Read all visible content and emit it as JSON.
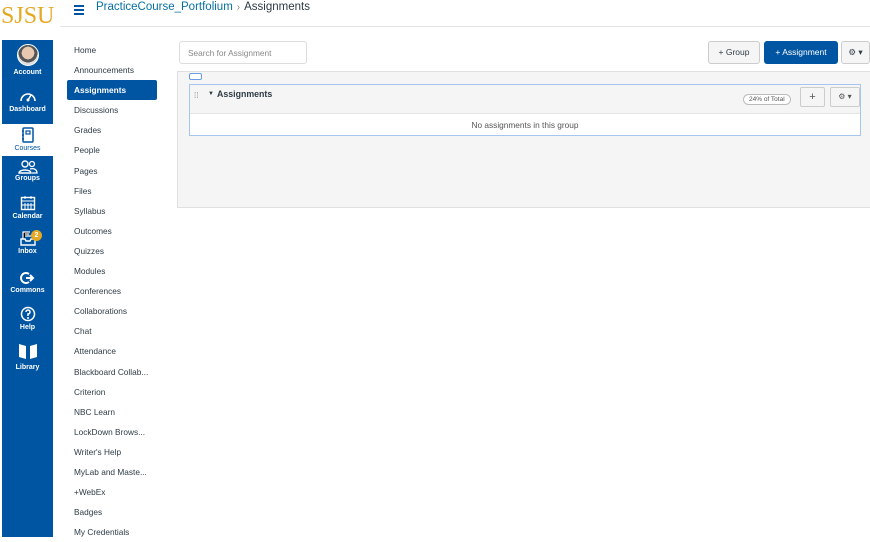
{
  "logo": "SJSU",
  "header": {
    "breadcrumb": [
      {
        "label": "PracticeCourse_Portfolium"
      },
      {
        "label": "Assignments"
      }
    ],
    "separator": "›"
  },
  "global_nav": [
    {
      "label": "Account",
      "icon": "account-avatar"
    },
    {
      "label": "Dashboard",
      "icon": "dashboard-icon"
    },
    {
      "label": "Courses",
      "icon": "courses-icon",
      "active": true
    },
    {
      "label": "Groups",
      "icon": "groups-icon"
    },
    {
      "label": "Calendar",
      "icon": "calendar-icon"
    },
    {
      "label": "Inbox",
      "icon": "inbox-icon",
      "badge": "2"
    },
    {
      "label": "Commons",
      "icon": "commons-icon"
    },
    {
      "label": "Help",
      "icon": "help-icon"
    },
    {
      "label": "Library",
      "icon": "library-icon"
    }
  ],
  "course_nav": [
    "Home",
    "Announcements",
    "Assignments",
    "Discussions",
    "Grades",
    "People",
    "Pages",
    "Files",
    "Syllabus",
    "Outcomes",
    "Quizzes",
    "Modules",
    "Conferences",
    "Collaborations",
    "Chat",
    "Attendance",
    "Blackboard Collab...",
    "Criterion",
    "NBC Learn",
    "LockDown Brows...",
    "Writer's Help",
    "MyLab and Maste...",
    "+WebEx",
    "Badges",
    "My Credentials"
  ],
  "course_nav_active": "Assignments",
  "toolbar": {
    "search_placeholder": "Search for Assignment",
    "group_button": "+ Group",
    "assignment_button": "+ Assignment",
    "settings_button": "⚙ ▾"
  },
  "assignment_group": {
    "title": "Assignments",
    "weight": "24% of Total",
    "add_button": "+",
    "settings_button": "⚙ ▾",
    "empty_message": "No assignments in this group"
  },
  "colors": {
    "brand_blue": "#0055a2",
    "logo_gold": "#e5a823",
    "link": "#0770a3"
  }
}
